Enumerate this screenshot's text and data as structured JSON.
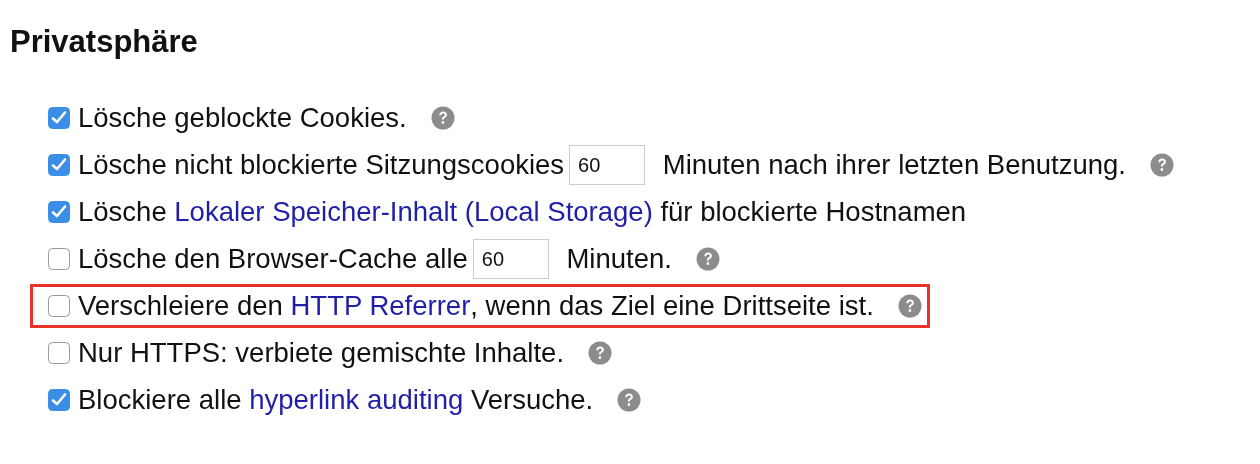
{
  "title": "Privatsphäre",
  "options": [
    {
      "checked": true,
      "help": true,
      "highlighted": false,
      "parts": [
        {
          "kind": "text",
          "text": "Lösche geblockte Cookies."
        }
      ]
    },
    {
      "checked": true,
      "help": true,
      "highlighted": false,
      "parts": [
        {
          "kind": "text",
          "text": "Lösche nicht blockierte Sitzungscookies"
        },
        {
          "kind": "input",
          "value": "60"
        },
        {
          "kind": "text",
          "text": "Minuten nach ihrer letzten Benutzung."
        }
      ]
    },
    {
      "checked": true,
      "help": false,
      "highlighted": false,
      "parts": [
        {
          "kind": "text",
          "text": "Lösche"
        },
        {
          "kind": "link",
          "text": "Lokaler Speicher-Inhalt (Local Storage)"
        },
        {
          "kind": "text",
          "text": "für blockierte Hostnamen"
        }
      ]
    },
    {
      "checked": false,
      "help": true,
      "highlighted": false,
      "parts": [
        {
          "kind": "text",
          "text": "Lösche den Browser-Cache alle"
        },
        {
          "kind": "input",
          "value": "60"
        },
        {
          "kind": "text",
          "text": "Minuten."
        }
      ]
    },
    {
      "checked": false,
      "help": true,
      "highlighted": true,
      "parts": [
        {
          "kind": "text",
          "text": "Verschleiere den"
        },
        {
          "kind": "link",
          "text": "HTTP Referrer"
        },
        {
          "kind": "text",
          "text": ", wenn das Ziel eine Drittseite ist."
        }
      ]
    },
    {
      "checked": false,
      "help": true,
      "highlighted": false,
      "parts": [
        {
          "kind": "text",
          "text": "Nur HTTPS: verbiete gemischte Inhalte."
        }
      ]
    },
    {
      "checked": true,
      "help": true,
      "highlighted": false,
      "parts": [
        {
          "kind": "text",
          "text": "Blockiere alle"
        },
        {
          "kind": "link",
          "text": "hyperlink auditing"
        },
        {
          "kind": "text",
          "text": "Versuche."
        }
      ]
    }
  ]
}
